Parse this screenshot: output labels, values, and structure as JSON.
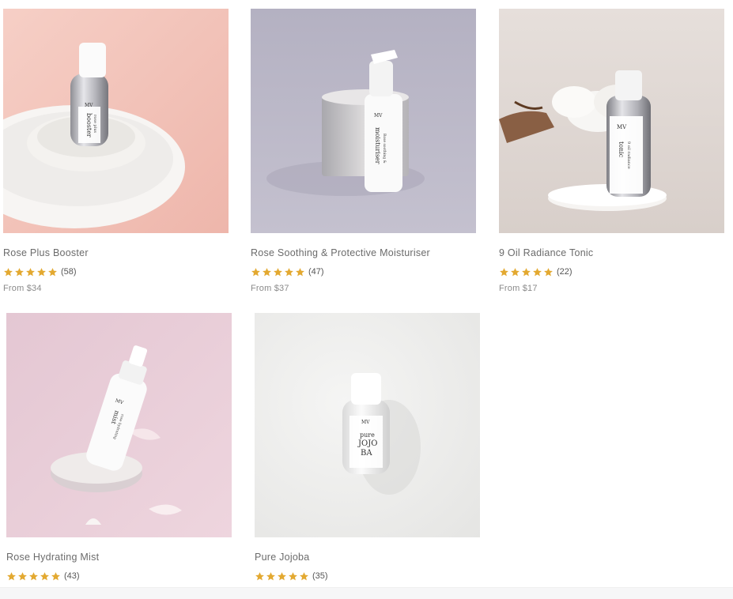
{
  "products": [
    {
      "name": "Rose Plus Booster",
      "rating": 5,
      "review_count": "(58)",
      "price": "From $34",
      "image_icon": "booster-bottle-photo",
      "bottle_labels": [
        "MV",
        "booster",
        "rose plus"
      ],
      "bg_color": "#f3c9c1"
    },
    {
      "name": "Rose Soothing & Protective Moisturiser",
      "rating": 5,
      "review_count": "(47)",
      "price": "From $37",
      "image_icon": "moisturiser-pump-photo",
      "bottle_labels": [
        "MV",
        "moisturiser",
        "Rose soothing & protective"
      ],
      "bg_color": "#b9b6c6"
    },
    {
      "name": "9 Oil Radiance Tonic",
      "rating": 5,
      "review_count": "(22)",
      "price": "From $17",
      "image_icon": "tonic-bottle-photo",
      "bottle_labels": [
        "MV",
        "tonic",
        "9 oil radiance"
      ],
      "bg_color": "#e2dcd8"
    },
    {
      "name": "Rose Hydrating Mist",
      "rating": 5,
      "review_count": "(43)",
      "price": "",
      "image_icon": "mist-spray-photo",
      "bottle_labels": [
        "MV",
        "mist",
        "rose hydrating"
      ],
      "bg_color": "#e7ccd7"
    },
    {
      "name": "Pure Jojoba",
      "rating": 5,
      "review_count": "(35)",
      "price": "",
      "image_icon": "jojoba-bottle-photo",
      "bottle_labels": [
        "MV",
        "pure",
        "JOJO",
        "BA"
      ],
      "bg_color": "#ececeb"
    }
  ],
  "colors": {
    "star": "#e3a931",
    "text": "#6b6b6b",
    "price": "#8a8a8a"
  }
}
